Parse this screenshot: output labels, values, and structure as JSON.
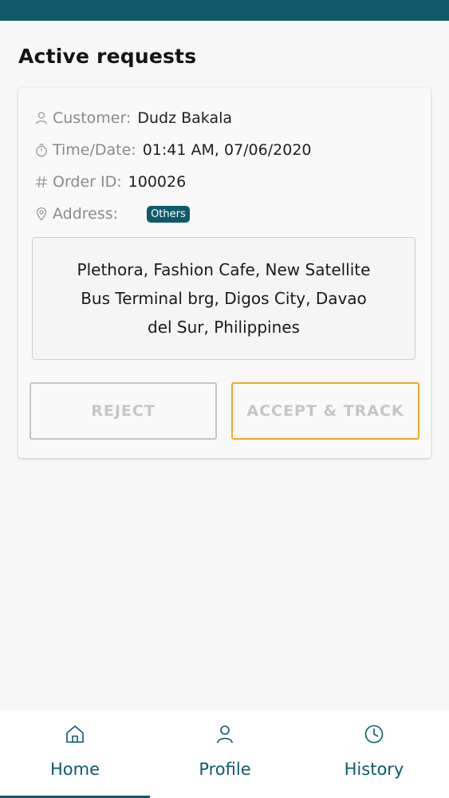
{
  "header": {
    "title": "Active requests"
  },
  "request": {
    "customer_label": "Customer:",
    "customer_value": "Dudz Bakala",
    "time_label": "Time/Date:",
    "time_value": "01:41 AM, 07/06/2020",
    "order_label": "Order ID:",
    "order_value": "100026",
    "address_label": "Address:",
    "address_badge": "Others",
    "address_text": "Plethora, Fashion Cafe, New Satellite Bus Terminal brg, Digos City, Davao del Sur, Philippines",
    "reject_label": "REJECT",
    "accept_label": "ACCEPT & TRACK"
  },
  "nav": {
    "items": [
      {
        "label": "Home",
        "icon": "home-icon",
        "active": true
      },
      {
        "label": "Profile",
        "icon": "person-icon",
        "active": false
      },
      {
        "label": "History",
        "icon": "clock-icon",
        "active": false
      }
    ]
  },
  "colors": {
    "accent": "#0e5a6b",
    "accept_border": "#f0a928",
    "disabled_text": "#c6c6c6"
  }
}
